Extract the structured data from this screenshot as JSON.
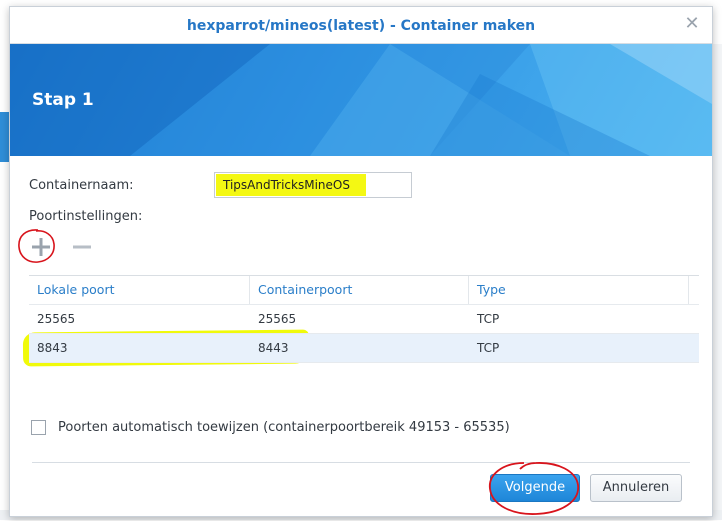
{
  "dialog": {
    "title": "hexparrot/mineos(latest) - Container maken",
    "close_icon": "close-icon",
    "step_title": "Stap 1"
  },
  "form": {
    "container_name_label": "Containernaam:",
    "container_name_value": "TipsAndTricksMineOS",
    "port_settings_label": "Poortinstellingen:",
    "add_icon": "plus-icon",
    "remove_icon": "minus-icon"
  },
  "ports_table": {
    "columns": [
      "Lokale poort",
      "Containerpoort",
      "Type"
    ],
    "rows": [
      {
        "local": "25565",
        "container": "25565",
        "type": "TCP"
      },
      {
        "local": "8843",
        "container": "8443",
        "type": "TCP"
      }
    ],
    "selected_row": 1
  },
  "auto_assign": {
    "label": "Poorten automatisch toewijzen (containerpoortbereik 49153 - 65535)",
    "checked": false
  },
  "footer": {
    "next_label": "Volgende",
    "cancel_label": "Annuleren"
  },
  "colors": {
    "accent": "#2677c6",
    "highlight": "#f0fa0a",
    "annotation": "#d8141c"
  }
}
